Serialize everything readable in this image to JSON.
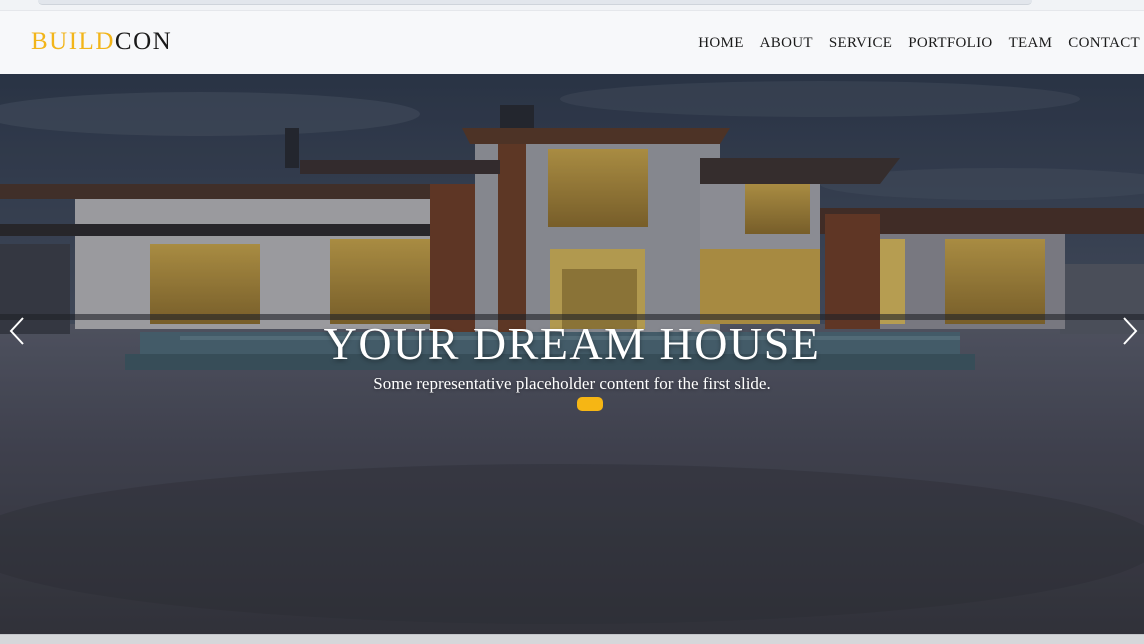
{
  "brand": {
    "accent": "BUILD",
    "rest": "CON",
    "accent_color": "#f2b51a"
  },
  "nav": {
    "items": [
      {
        "label": "HOME"
      },
      {
        "label": "ABOUT"
      },
      {
        "label": "SERVICE"
      },
      {
        "label": "PORTFOLIO"
      },
      {
        "label": "TEAM"
      },
      {
        "label": "CONTACT"
      }
    ]
  },
  "hero": {
    "title": "YOUR DREAM HOUSE",
    "subtitle": "Some representative placeholder content for the first slide.",
    "indicator_color": "#f6b614",
    "prev_icon": "chevron-left-icon",
    "next_icon": "chevron-right-icon"
  }
}
